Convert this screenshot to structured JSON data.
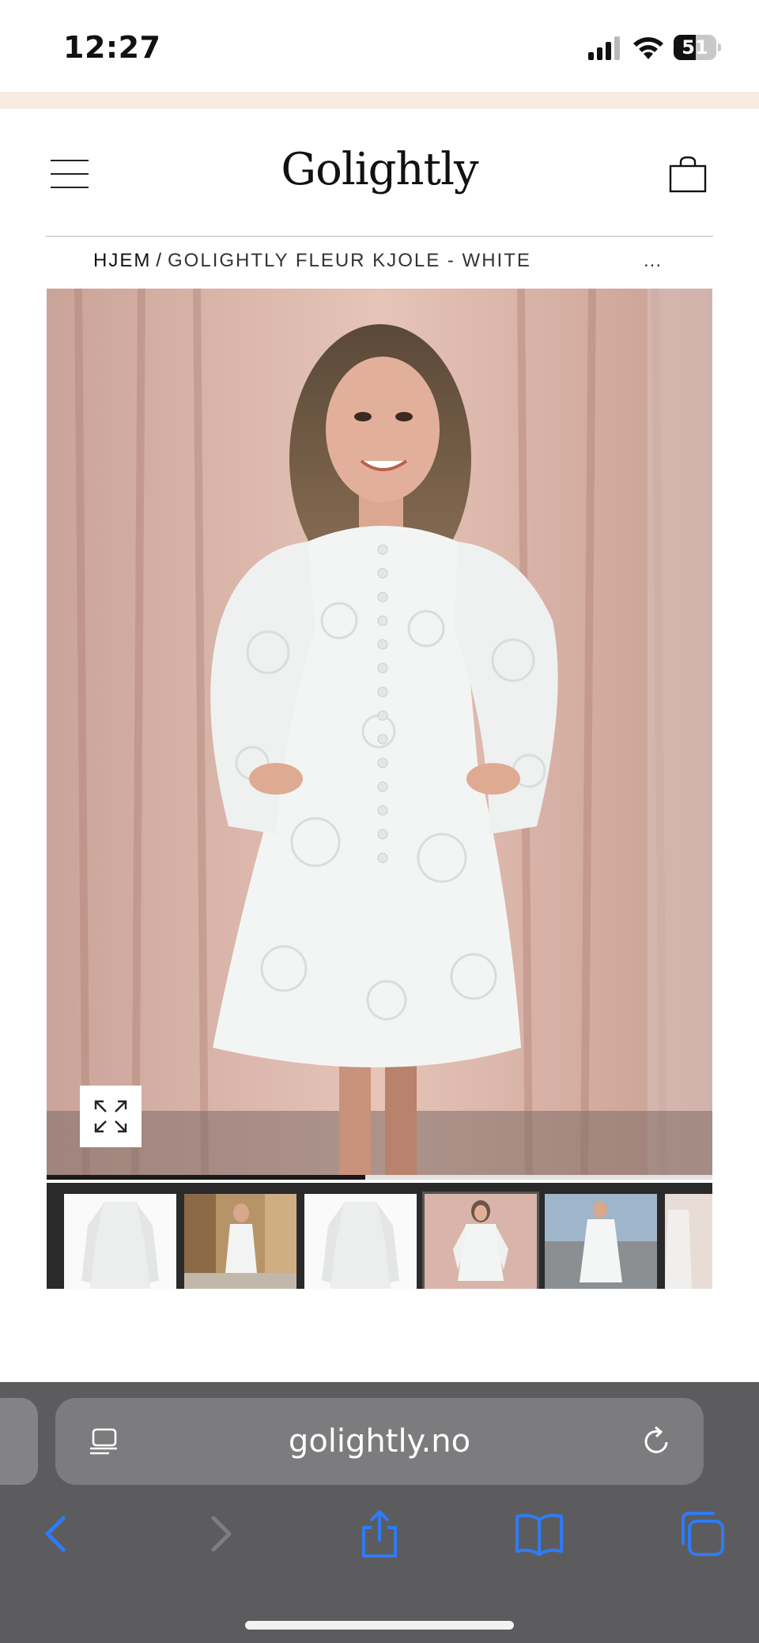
{
  "status_bar": {
    "time": "12:27",
    "battery_level": "51",
    "battery_fraction": 0.51
  },
  "colors": {
    "promo_strip": "#f7ebe2",
    "safari_bar": "#5c5c5e",
    "ios_blue": "#2f7bf5",
    "nav_disabled": "#7e7e82"
  },
  "header": {
    "logo_text": "Golightly",
    "menu_icon": "hamburger-menu-icon",
    "cart_icon": "shopping-bag-icon"
  },
  "breadcrumb": {
    "home": "HJEM",
    "separator": "/",
    "current": "GOLIGHTLY FLEUR KJOLE - WHITE",
    "more": "..."
  },
  "product": {
    "main_image_icon": "product-photo-white-lace-dress",
    "expand_icon": "expand-arrows-icon",
    "gallery_progress": 0.57
  },
  "thumbnails": [
    {
      "icon": "white-dress-flatlay-photo",
      "active": false
    },
    {
      "icon": "model-street-photo",
      "active": false
    },
    {
      "icon": "white-dress-flatlay-photo",
      "active": false
    },
    {
      "icon": "model-curtain-photo",
      "active": true
    },
    {
      "icon": "model-dock-photo",
      "active": false
    },
    {
      "icon": "model-partial-photo",
      "active": false
    }
  ],
  "browser": {
    "url": "golightly.no",
    "reader_icon": "page-menu-icon",
    "reload_icon": "reload-icon",
    "nav": [
      "back-icon",
      "forward-icon",
      "share-icon",
      "bookmarks-icon",
      "tabs-icon"
    ]
  }
}
